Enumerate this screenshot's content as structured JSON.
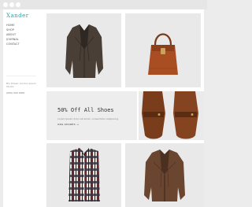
{
  "browser": {
    "dots": [
      "#ffffff",
      "#ffffff",
      "#ffffff"
    ]
  },
  "site": {
    "logo": "Xander",
    "nav": [
      "HOME",
      "SHOP",
      "ABOUT",
      "JOURNAL",
      "CONTACT"
    ],
    "contact_text": "Blo Street, London Ipsum Studio",
    "phone": "(000) 000 0000"
  },
  "grid": {
    "tile_1": {
      "label": "leather-jacket-product"
    },
    "tile_2": {
      "label": "leather-handbag-product"
    },
    "promo": {
      "title": "50% Off All Shoes",
      "subtitle": "Lorem ipsum dolor sit amet, consectetur adipiscing",
      "link": "ORG.SHARES →"
    },
    "tile_3": {
      "label": "leather-shoes-product"
    },
    "tile_4": {
      "label": "plaid-shirt-product"
    },
    "tile_5": {
      "label": "brown-leather-jacket-product"
    }
  }
}
